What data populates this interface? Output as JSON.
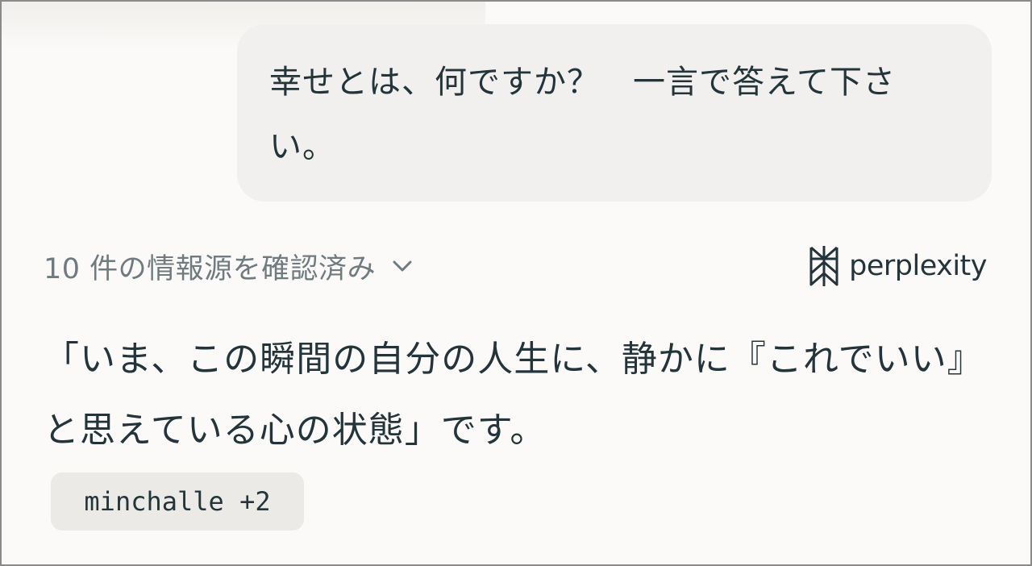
{
  "conversation": {
    "user_message": "幸せとは、何ですか？　一言で答えて下さい。",
    "sources": {
      "label": "10 件の情報源を確認済み",
      "icon": "chevron-down-icon"
    },
    "brand": {
      "logo_icon": "perplexity-logo-icon",
      "name": "perplexity"
    },
    "answer": "「いま、この瞬間の自分の人生に、静かに『これでいい』と思えている心の状態」です。",
    "citation_chip": "minchalle +2"
  },
  "colors": {
    "background": "#fbfaf8",
    "bubble": "#f1f0ee",
    "text": "#23353a",
    "muted_text": "#6f7b7e",
    "chip": "#ebeae7"
  }
}
